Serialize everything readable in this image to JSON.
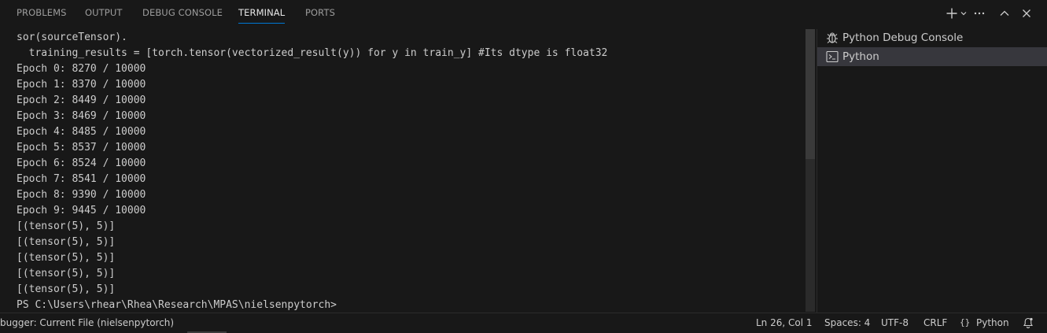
{
  "panel": {
    "tabs": [
      {
        "label": "PROBLEMS"
      },
      {
        "label": "OUTPUT"
      },
      {
        "label": "DEBUG CONSOLE"
      },
      {
        "label": "TERMINAL",
        "active": true
      },
      {
        "label": "PORTS"
      }
    ],
    "actions": [
      "plus-icon",
      "chevron-down-icon",
      "more-icon",
      "chevron-up-icon",
      "close-icon"
    ]
  },
  "terminal": {
    "lines": [
      "sor(sourceTensor).",
      "  training_results = [torch.tensor(vectorized_result(y)) for y in train_y] #Its dtype is float32",
      "Epoch 0: 8270 / 10000",
      "Epoch 1: 8370 / 10000",
      "Epoch 2: 8449 / 10000",
      "Epoch 3: 8469 / 10000",
      "Epoch 4: 8485 / 10000",
      "Epoch 5: 8537 / 10000",
      "Epoch 6: 8524 / 10000",
      "Epoch 7: 8541 / 10000",
      "Epoch 8: 9390 / 10000",
      "Epoch 9: 9445 / 10000",
      "[(tensor(5), 5)]",
      "[(tensor(5), 5)]",
      "[(tensor(5), 5)]",
      "[(tensor(5), 5)]",
      "[(tensor(5), 5)]",
      "PS C:\\Users\\rhear\\Rhea\\Research\\MPAS\\nielsenpytorch>"
    ]
  },
  "terminal_list": {
    "items": [
      {
        "label": "Python Debug Console",
        "icon": "debug-icon"
      },
      {
        "label": "Python",
        "icon": "terminal-icon",
        "selected": true
      }
    ]
  },
  "statusbar": {
    "left": "bugger: Current File (nielsenpytorch)",
    "position": "Ln 26, Col 1",
    "spaces": "Spaces: 4",
    "encoding": "UTF-8",
    "eol": "CRLF",
    "language_braces": "{}",
    "language": "Python",
    "notifications_icon": "bell-icon"
  },
  "colors": {
    "background": "#181818",
    "accent": "#0078d4",
    "selected_item": "#37373d",
    "text": "#cccccc"
  }
}
